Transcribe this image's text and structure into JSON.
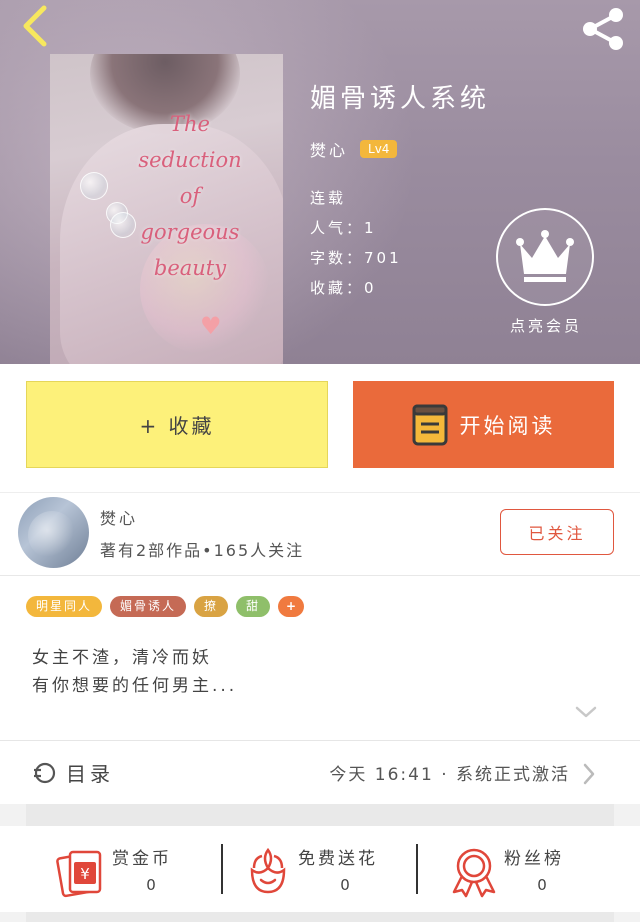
{
  "header": {
    "back_icon": "chevron-left-icon",
    "share_icon": "share-icon",
    "cover_title": "The\nseduction\nof\ngorgeous\nbeauty",
    "book_title": "媚骨诱人系统",
    "author": "燓心",
    "level": "Lv4",
    "status": "连载",
    "popularity": "人气：1",
    "word_count": "字数：701",
    "favorites": "收藏：0",
    "vip_label": "点亮会员"
  },
  "actions": {
    "collect_label": "+ 收藏",
    "read_label": "开始阅读",
    "collect_color": "#fdf17a",
    "read_color": "#ea6a3b"
  },
  "author_card": {
    "name": "燓心",
    "stats": "著有2部作品•165人关注",
    "follow_label": "已关注"
  },
  "tags": [
    {
      "label": "明星同人",
      "color": "#f3b73c"
    },
    {
      "label": "媚骨诱人",
      "color": "#c56a55"
    },
    {
      "label": "撩",
      "color": "#d9a343"
    },
    {
      "label": "甜",
      "color": "#8fbf6a"
    },
    {
      "label": "+",
      "color": "#f07a3f"
    }
  ],
  "intro": {
    "line1": "女主不渣，清冷而妖",
    "line2": "有你想要的任何男主..."
  },
  "catalog": {
    "label": "目录",
    "latest": "今天 16:41 · 系统正式激活"
  },
  "bottom": {
    "reward_label": "赏金币",
    "reward_value": "0",
    "flower_label": "免费送花",
    "flower_value": "0",
    "fans_label": "粉丝榜",
    "fans_value": "0",
    "accent": "#e0473a"
  }
}
